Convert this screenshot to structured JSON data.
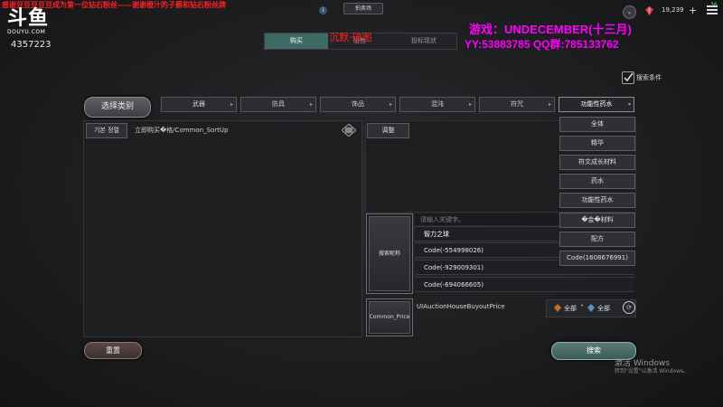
{
  "stream": {
    "marquee": "感谢豆豆豆豆豆成为第一位钻石粉丝——谢谢橙汁的子爵和钻石粉丝牌",
    "logo_glyph": "斗鱼",
    "logo_sub": "DOUYU.COM",
    "room_id": "4357223",
    "red_overlay": "沉默·破图",
    "game_line": "游戏：UNDECEMBER(十三月)",
    "contact_line": "YY:53883785   QQ群:785133762",
    "ping": "36"
  },
  "header": {
    "auction_label": "拍卖场",
    "info_icon": "i",
    "currency_value": "19,239",
    "plus": "+"
  },
  "tabs": [
    {
      "label": "购买",
      "active": true
    },
    {
      "label": "出售",
      "active": false
    },
    {
      "label": "投标现状",
      "active": false
    }
  ],
  "search_conditions": "搜索条件",
  "category_select": "选择类别",
  "categories": [
    {
      "label": "武器"
    },
    {
      "label": "防具"
    },
    {
      "label": "饰品"
    },
    {
      "label": "混沌"
    },
    {
      "label": "符咒"
    },
    {
      "label": "功能性药水"
    }
  ],
  "arrow_glyph": "▸",
  "dropdown_arrow": "▾",
  "dropdown_items": [
    "全体",
    "精华",
    "符文成长材料",
    "药水",
    "功能性药水",
    "�金�材料",
    "配方",
    "Code(1608676991)"
  ],
  "left_panel": {
    "sort_button": "기본 정렬",
    "sort_text": "立即购买�格/Common_SortUp"
  },
  "right_panel": {
    "refine_button": "调整",
    "search_name_button": "搜索昵称",
    "search_placeholder": "请输入关键字。",
    "results": [
      "智力之球",
      "Code(-554998026)",
      "Code(-929009301)",
      "Code(-694066605)"
    ],
    "price_button": "Common_Price",
    "price_label": "UIAuctionHouseBuyoutPrice",
    "grade_all_1": "全部",
    "grade_all_2": "全部"
  },
  "bottom": {
    "reset": "重置",
    "search": "搜索"
  },
  "windows": {
    "activate": "激活 Windows",
    "hint": "转到\"设置\"以激活 Windows。"
  },
  "colors": {
    "accent_teal": "#3d6a64",
    "search_button": "#5c7d77",
    "reset_button": "#5a4744",
    "magenta_overlay": "#ff00ff",
    "red_overlay": "#ff2222"
  }
}
